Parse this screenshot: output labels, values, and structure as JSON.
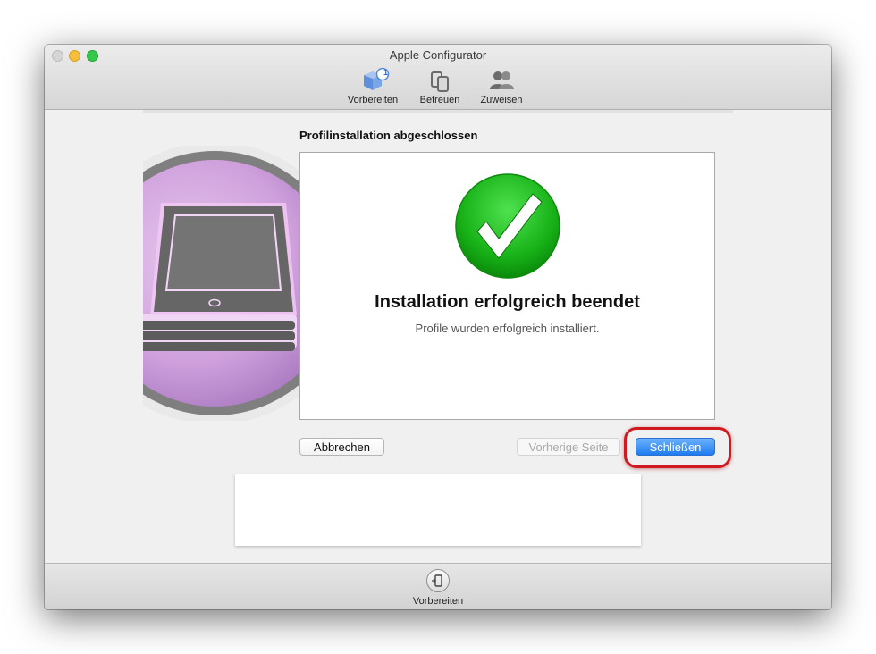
{
  "window": {
    "title": "Apple Configurator"
  },
  "toolbar": {
    "items": [
      {
        "label": "Vorbereiten",
        "icon": "prepare-icon",
        "badge": "1",
        "selected": true
      },
      {
        "label": "Betreuen",
        "icon": "devices-icon"
      },
      {
        "label": "Zuweisen",
        "icon": "users-icon"
      }
    ]
  },
  "sheet": {
    "section_title": "Profilinstallation abgeschlossen",
    "success_title": "Installation erfolgreich beendet",
    "success_subtitle": "Profile wurden erfolgreich installiert.",
    "buttons": {
      "cancel": "Abbrechen",
      "previous": "Vorherige Seite",
      "close": "Schließen"
    }
  },
  "bottom_bar": {
    "action_label": "Vorbereiten",
    "icon": "prepare-device-icon"
  },
  "colors": {
    "accent_blue": "#1e7bf0",
    "success_green": "#1fb51f",
    "highlight_red": "#d01a22",
    "hero_purple": "#c79ad8"
  }
}
